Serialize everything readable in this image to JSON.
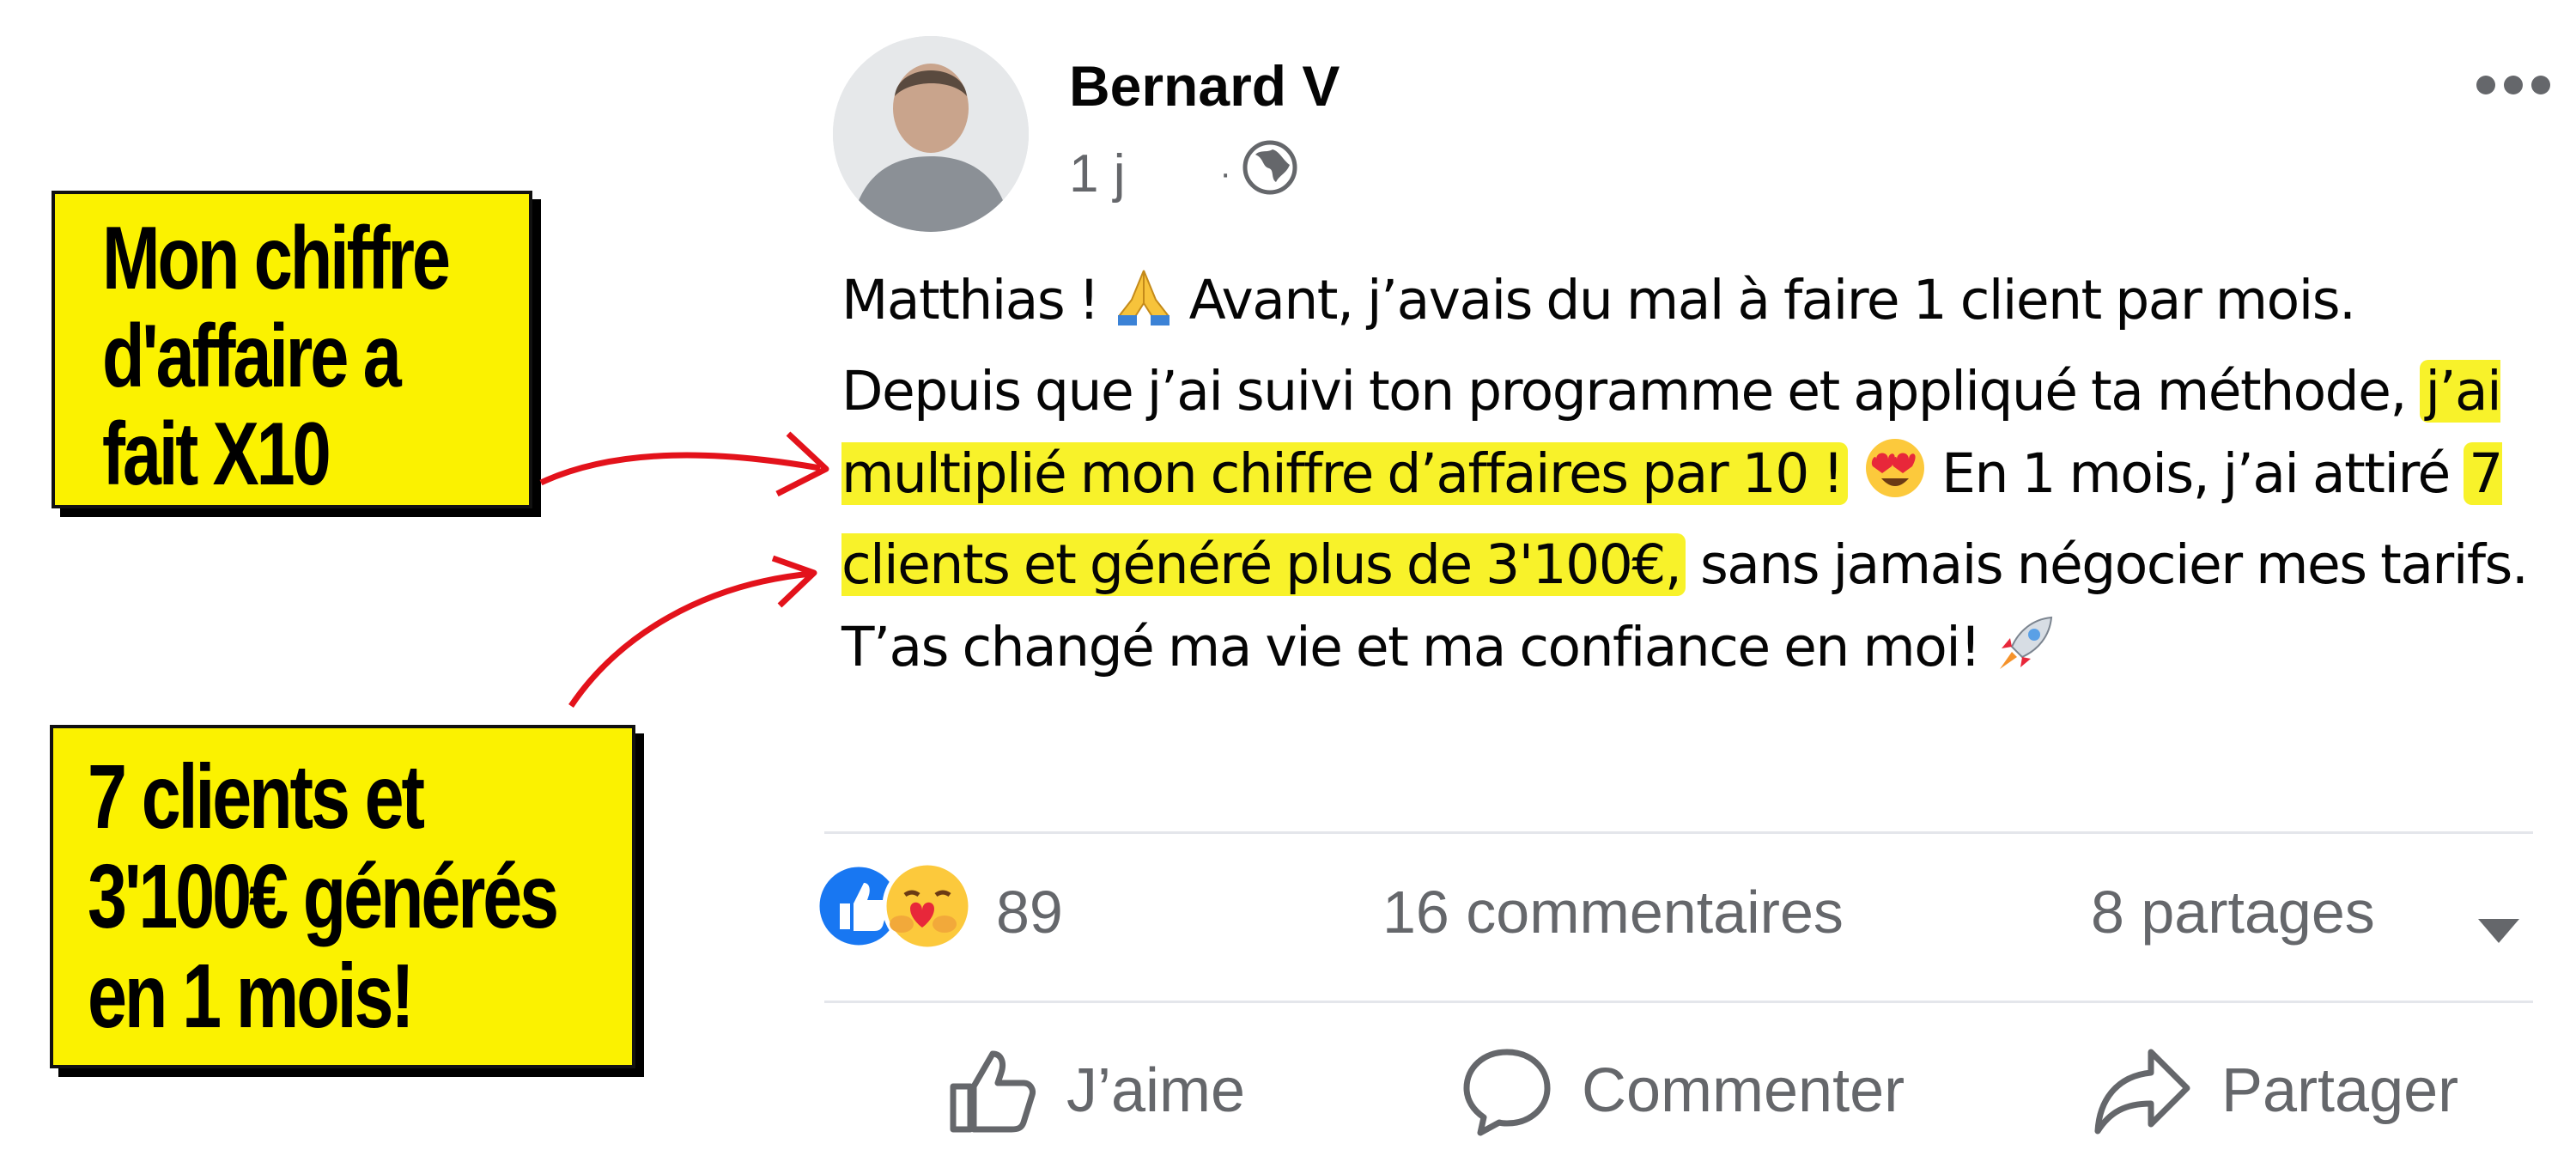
{
  "callouts": {
    "first": [
      "Mon chiffre",
      "d'affaire a",
      "fait X10"
    ],
    "second": [
      "7 clients et",
      "3'100€ générés",
      "en 1 mois!"
    ]
  },
  "post": {
    "author": "Bernard V",
    "time": "1 j",
    "separator": "·",
    "body": {
      "p1": "Matthias ! ",
      "p2": " Avant, j’avais du mal à faire 1 client par mois. Depuis que j’ai suivi ton programme et appliqué ta méthode,",
      "hl1": "j’ai multiplié mon chiffre d’affaires par 10 !",
      "p3": " En 1 mois, j’ai attiré ",
      "hl2": "7 clients et généré plus de 3'100€,",
      "p4": " sans jamais négocier mes tarifs. T’as changé ma vie et ma confiance en moi! "
    }
  },
  "stats": {
    "reactions": "89",
    "comments": "16 commentaires",
    "shares": "8 partages"
  },
  "actions": {
    "like": "J’aime",
    "comment": "Commenter",
    "share": "Partager"
  },
  "colors": {
    "highlight": "#f8f22a",
    "callout": "#fbf200",
    "arrow": "#e3121b",
    "like_blue": "#1877f2",
    "muted": "#65676b"
  },
  "icons": [
    "globe-icon",
    "more-icon",
    "pray-emoji",
    "heart-eyes-emoji",
    "rocket-emoji",
    "like-reaction-icon",
    "care-reaction-icon",
    "thumbs-up-icon",
    "comment-bubble-icon",
    "share-arrow-icon",
    "caret-down-icon"
  ]
}
